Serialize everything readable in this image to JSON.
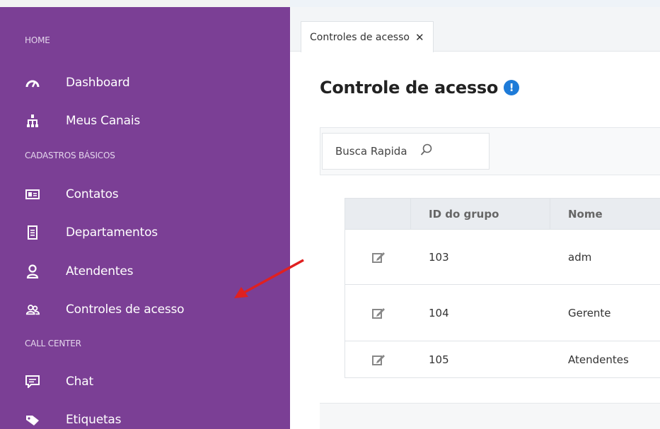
{
  "sidebar": {
    "sections": [
      {
        "label": "HOME"
      },
      {
        "label": "CADASTROS BÁSICOS"
      },
      {
        "label": "CALL CENTER"
      }
    ],
    "items": [
      {
        "label": "Dashboard",
        "icon": "speedometer-icon"
      },
      {
        "label": "Meus Canais",
        "icon": "sitemap-icon"
      },
      {
        "label": "Contatos",
        "icon": "id-card-icon"
      },
      {
        "label": "Departamentos",
        "icon": "document-icon"
      },
      {
        "label": "Atendentes",
        "icon": "user-icon"
      },
      {
        "label": "Controles de acesso",
        "icon": "users-group-icon"
      },
      {
        "label": "Chat",
        "icon": "chat-icon"
      },
      {
        "label": "Etiquetas",
        "icon": "tag-icon"
      }
    ]
  },
  "tabs": [
    {
      "label": "Controles de acesso",
      "close": "✕"
    }
  ],
  "page": {
    "title": "Controle de acesso",
    "info_badge": "!"
  },
  "search": {
    "label": "Busca Rapida"
  },
  "table": {
    "columns": [
      "",
      "ID do grupo",
      "Nome"
    ],
    "rows": [
      {
        "id": "103",
        "nome": "adm"
      },
      {
        "id": "104",
        "nome": "Gerente"
      },
      {
        "id": "105",
        "nome": "Atendentes"
      }
    ]
  },
  "colors": {
    "sidebar_bg": "#7b3f95",
    "annotation_arrow": "#e02020",
    "info_badge": "#1e7bd8"
  }
}
